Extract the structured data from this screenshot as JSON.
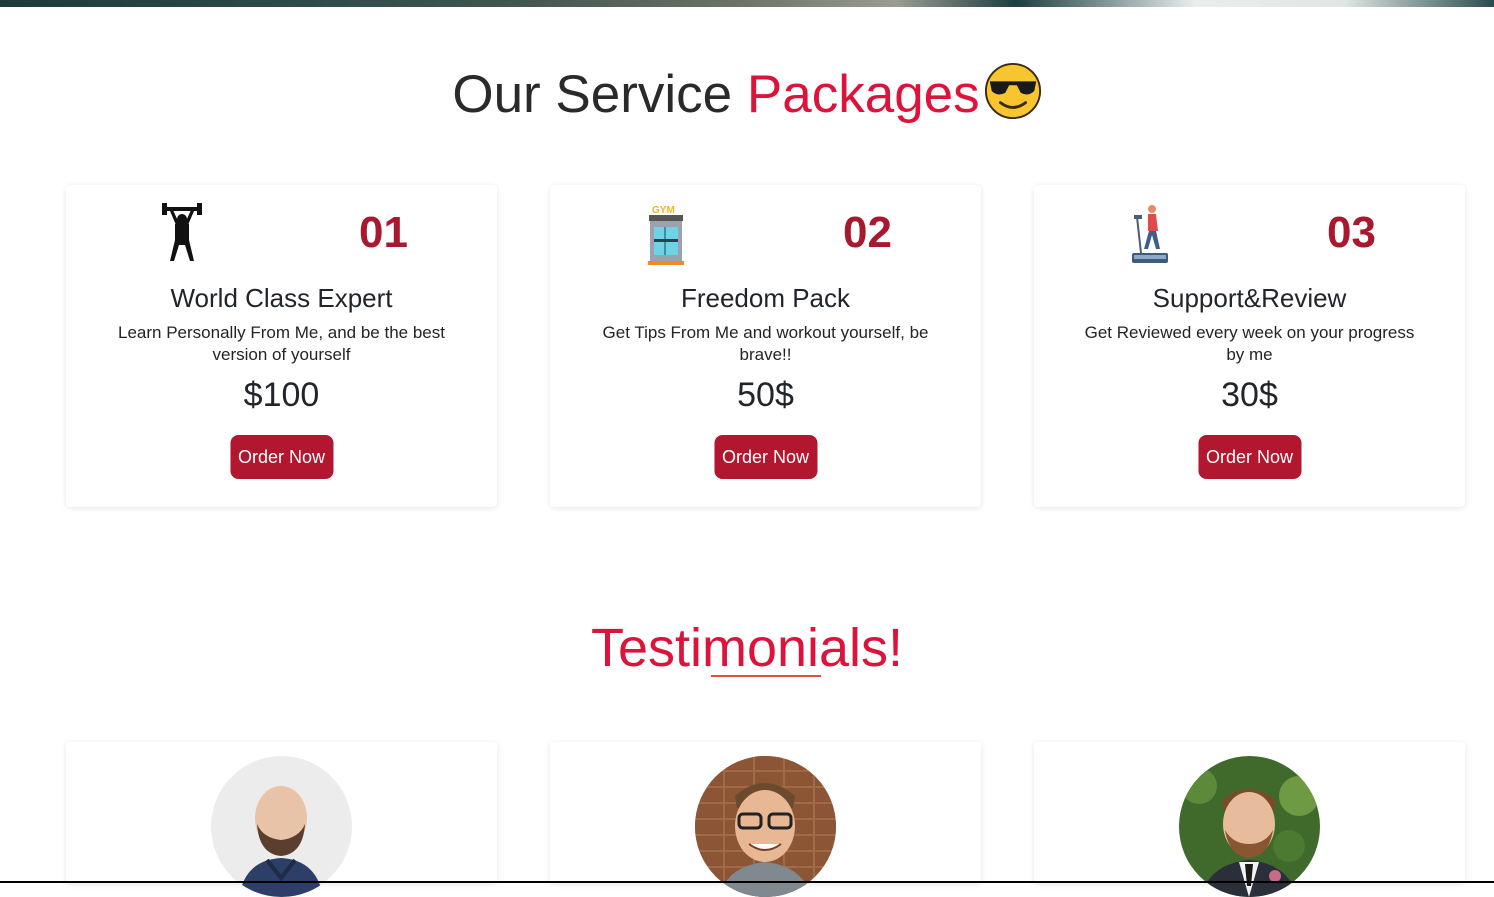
{
  "packages": {
    "title_main": "Our Service",
    "title_accent": "Packages",
    "title_emoji_icon": "smiling-face-with-sunglasses-icon",
    "cards": [
      {
        "number": "01",
        "name": "World Class Expert",
        "description": "Learn Personally From Me, and be the best version of yourself",
        "price": "$100",
        "button_label": "Order Now",
        "icon": "weightlifter-icon"
      },
      {
        "number": "02",
        "name": "Freedom Pack",
        "description": "Get Tips From Me and workout yourself, be brave!!",
        "price": "50$",
        "button_label": "Order Now",
        "icon": "gym-building-icon"
      },
      {
        "number": "03",
        "name": "Support&Review",
        "description": "Get Reviewed every week on your progress by me",
        "price": "30$",
        "button_label": "Order Now",
        "icon": "treadmill-runner-icon"
      }
    ]
  },
  "testimonials": {
    "title": "Testimonials!",
    "avatars": [
      "bald-bearded-man-avatar",
      "man-with-glasses-avatar",
      "man-in-suit-avatar"
    ]
  },
  "colors": {
    "accent": "#dc143c",
    "number_color": "#a8182e",
    "button_bg": "#b3172f"
  }
}
